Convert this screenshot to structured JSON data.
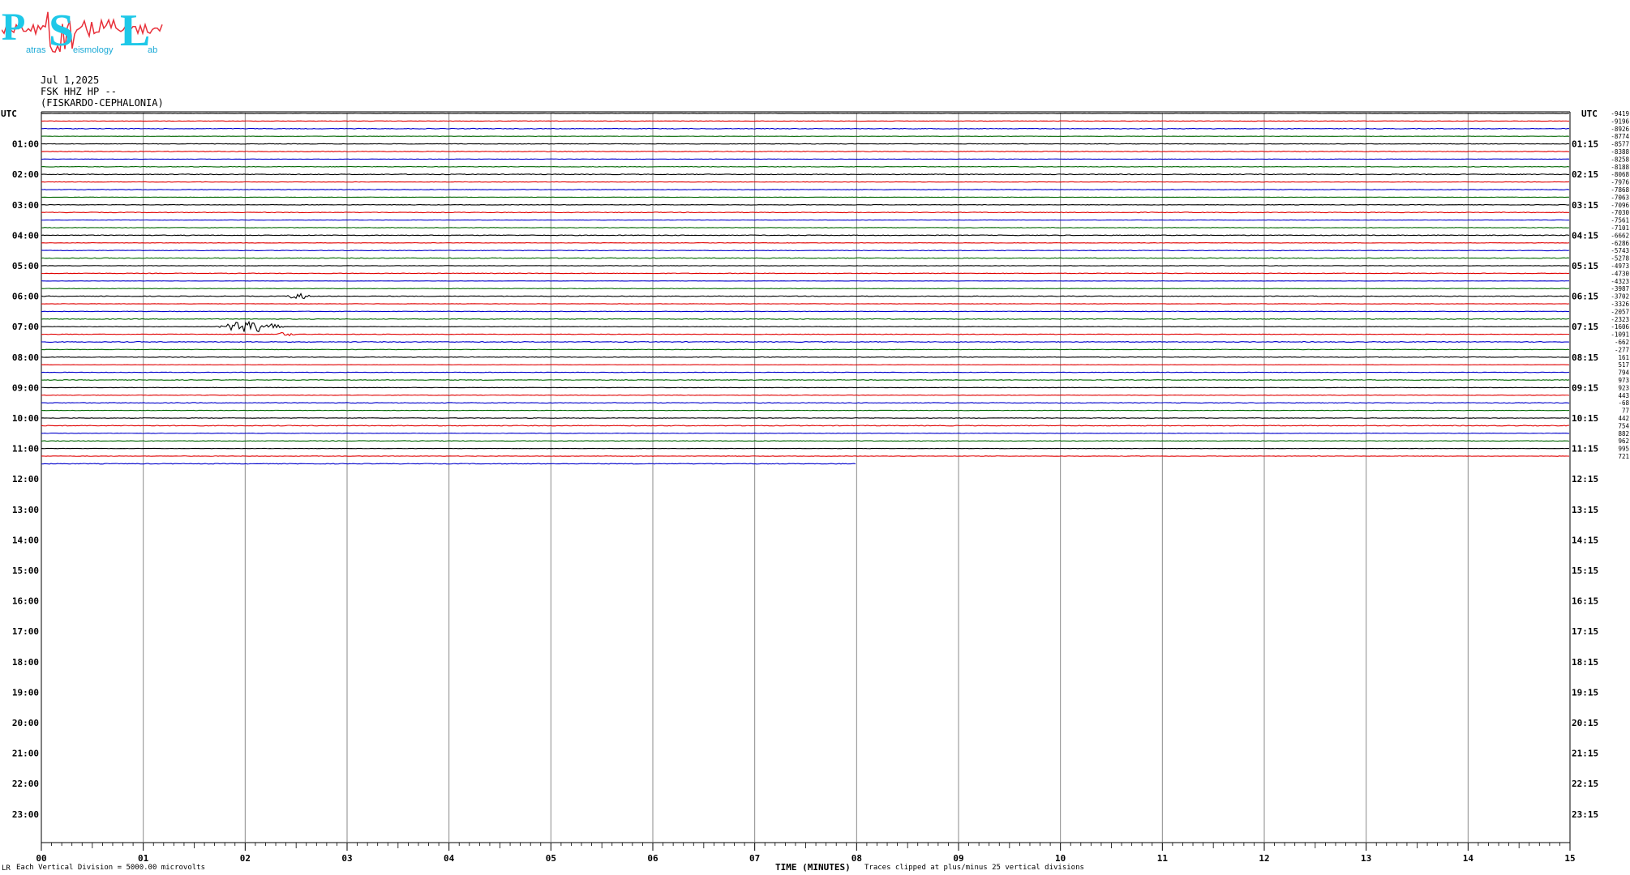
{
  "header": {
    "date": "Jul 1,2025",
    "station": "FSK HHZ HP --",
    "location": "(FISKARDO-CEPHALONIA)"
  },
  "logo": {
    "letters": [
      "P",
      "S",
      "L"
    ],
    "words": [
      "atras",
      "eismology",
      "ab"
    ],
    "colors": {
      "text": "#1ec8e8",
      "wave": "#e8303a"
    }
  },
  "footer": {
    "scale_note": "Each Vertical Division = 5000.00 microvolts",
    "xlabel": "TIME (MINUTES)",
    "clip_note": "Traces clipped at plus/minus 25 vertical divisions",
    "corner_mark": "LR"
  },
  "chart_data": {
    "type": "line",
    "xlabel": "TIME (MINUTES)",
    "x_ticks": [
      "00",
      "01",
      "02",
      "03",
      "04",
      "05",
      "06",
      "07",
      "08",
      "09",
      "10",
      "11",
      "12",
      "13",
      "14",
      "15"
    ],
    "xlim": [
      0,
      15
    ],
    "utc_label": "UTC",
    "left_hour_labels": [
      "01:00",
      "02:00",
      "03:00",
      "04:00",
      "05:00",
      "06:00",
      "07:00",
      "08:00",
      "09:00",
      "10:00",
      "11:00",
      "12:00",
      "13:00",
      "14:00",
      "15:00",
      "16:00",
      "17:00",
      "18:00",
      "19:00",
      "20:00",
      "21:00",
      "22:00",
      "23:00"
    ],
    "right_hour_labels": [
      "01:15",
      "02:15",
      "03:15",
      "04:15",
      "05:15",
      "06:15",
      "07:15",
      "08:15",
      "09:15",
      "10:15",
      "11:15",
      "12:15",
      "13:15",
      "14:15",
      "15:15",
      "16:15",
      "17:15",
      "18:15",
      "19:15",
      "20:15",
      "21:15",
      "22:15",
      "23:15"
    ],
    "trace_colors": [
      "#000000",
      "#e00000",
      "#0000cc",
      "#006600"
    ],
    "trace_count_full": 46,
    "last_trace_end_minute": 8.0,
    "trace_offsets": [
      "-9419",
      "-9196",
      "-8926",
      "-8774",
      "-8577",
      "-8388",
      "-8258",
      "-8188",
      "-8068",
      "-7976",
      "-7868",
      "-7063",
      "-7096",
      "-7030",
      "-7561",
      "-7101",
      "-6662",
      "-6286",
      "-5743",
      "-5278",
      "-4973",
      "-4730",
      "-4323",
      "-3987",
      "-3702",
      "-3326",
      "-2057",
      "-2323",
      "-1606",
      "-1091",
      "-662",
      "-277",
      "161",
      "517",
      "794",
      "973",
      "923",
      "443",
      "-68",
      "77",
      "442",
      "754",
      "882",
      "962",
      "995",
      "721"
    ],
    "events": [
      {
        "trace": 24,
        "minute_start": 2.4,
        "minute_end": 2.65,
        "amplitude": 4
      },
      {
        "trace": 28,
        "minute_start": 1.7,
        "minute_end": 2.4,
        "amplitude": 7
      },
      {
        "trace": 29,
        "minute_start": 2.3,
        "minute_end": 2.5,
        "amplitude": 3
      }
    ]
  }
}
